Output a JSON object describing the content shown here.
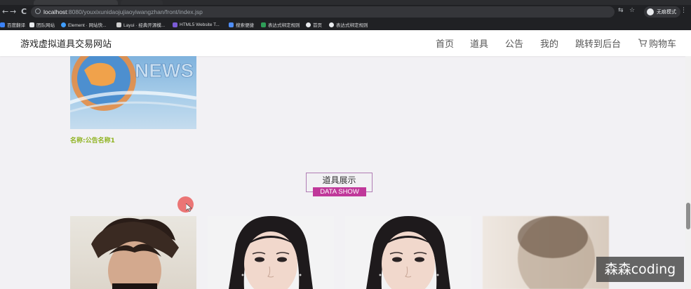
{
  "browser": {
    "url_host": "localhost",
    "url_rest": ":8080/youxixunidaojujiaoyiwangzhan/front/index.jsp",
    "back": "←",
    "forward": "→",
    "reload": "C",
    "incognito_label": "无痕模式",
    "bookmarks": [
      {
        "label": "百度翻译",
        "icon": "blue"
      },
      {
        "label": "团队网站",
        "icon": "flag"
      },
      {
        "label": "Element · 网站快...",
        "icon": "element"
      },
      {
        "label": "Layui · 经典开源模...",
        "icon": "layui"
      },
      {
        "label": "HTML5 Website T...",
        "icon": "purple"
      },
      {
        "label": "搜索便捷",
        "icon": "blue"
      },
      {
        "label": "表达式绑定规则",
        "icon": "green"
      },
      {
        "label": "首页",
        "icon": "github"
      },
      {
        "label": "表达式绑定规则",
        "icon": "github"
      }
    ]
  },
  "site": {
    "title": "游戏虚拟道具交易网站",
    "nav": [
      "首页",
      "道具",
      "公告",
      "我的",
      "跳转到后台",
      "购物车"
    ]
  },
  "notice": {
    "image_text": "NEWS",
    "caption": "名称:公告名称1"
  },
  "section": {
    "title": "道具展示",
    "subtitle": "DATA SHOW"
  },
  "watermark": "森森coding",
  "colors": {
    "accent": "#c0389a",
    "caption_green": "#8fb320"
  }
}
